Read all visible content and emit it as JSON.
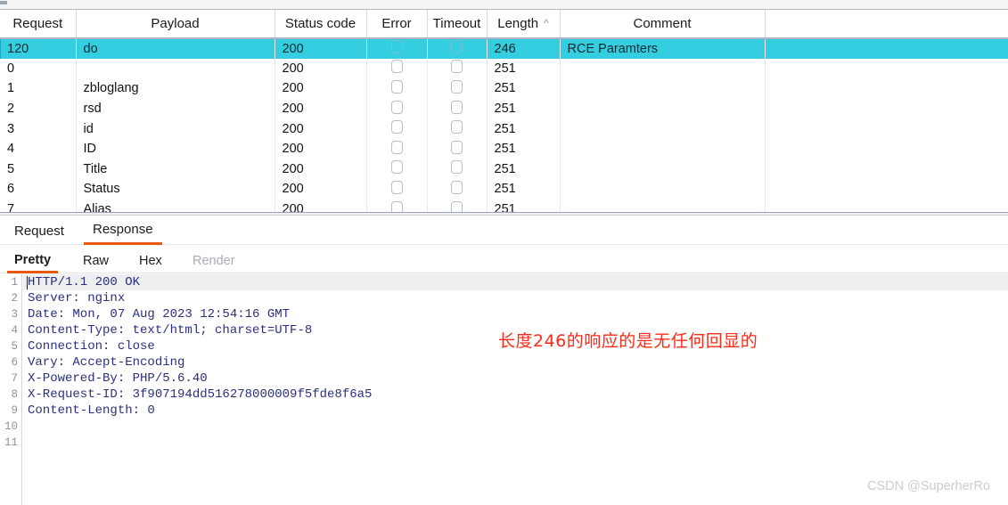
{
  "results_table": {
    "columns": [
      {
        "key": "request",
        "label": "Request"
      },
      {
        "key": "payload",
        "label": "Payload"
      },
      {
        "key": "status",
        "label": "Status code"
      },
      {
        "key": "error",
        "label": "Error"
      },
      {
        "key": "timeout",
        "label": "Timeout"
      },
      {
        "key": "length",
        "label": "Length"
      },
      {
        "key": "comment",
        "label": "Comment"
      }
    ],
    "sort": {
      "column": "Length",
      "direction": "ascending",
      "icon": "chevron-up-icon"
    },
    "selected_row_color": "#35cde0",
    "rows": [
      {
        "request": "120",
        "payload": "do",
        "status": "200",
        "error": false,
        "timeout": false,
        "length": "246",
        "comment": "RCE Paramters",
        "selected": true
      },
      {
        "request": "0",
        "payload": "",
        "status": "200",
        "error": false,
        "timeout": false,
        "length": "251",
        "comment": "",
        "selected": false
      },
      {
        "request": "1",
        "payload": "zbloglang",
        "status": "200",
        "error": false,
        "timeout": false,
        "length": "251",
        "comment": "",
        "selected": false
      },
      {
        "request": "2",
        "payload": "rsd",
        "status": "200",
        "error": false,
        "timeout": false,
        "length": "251",
        "comment": "",
        "selected": false
      },
      {
        "request": "3",
        "payload": "id",
        "status": "200",
        "error": false,
        "timeout": false,
        "length": "251",
        "comment": "",
        "selected": false
      },
      {
        "request": "4",
        "payload": "ID",
        "status": "200",
        "error": false,
        "timeout": false,
        "length": "251",
        "comment": "",
        "selected": false
      },
      {
        "request": "5",
        "payload": "Title",
        "status": "200",
        "error": false,
        "timeout": false,
        "length": "251",
        "comment": "",
        "selected": false
      },
      {
        "request": "6",
        "payload": "Status",
        "status": "200",
        "error": false,
        "timeout": false,
        "length": "251",
        "comment": "",
        "selected": false
      },
      {
        "request": "7",
        "payload": "Alias",
        "status": "200",
        "error": false,
        "timeout": false,
        "length": "251",
        "comment": "",
        "selected": false
      }
    ]
  },
  "message_tabs": {
    "items": [
      {
        "label": "Request",
        "active": false
      },
      {
        "label": "Response",
        "active": true
      }
    ],
    "active_underline_color": "#e8590c"
  },
  "view_tabs": {
    "items": [
      {
        "label": "Pretty",
        "active": true,
        "disabled": false
      },
      {
        "label": "Raw",
        "active": false,
        "disabled": false
      },
      {
        "label": "Hex",
        "active": false,
        "disabled": false
      },
      {
        "label": "Render",
        "active": false,
        "disabled": true
      }
    ]
  },
  "editor": {
    "line_numbers": [
      "1",
      "2",
      "3",
      "4",
      "5",
      "6",
      "7",
      "8",
      "9",
      "10",
      "11"
    ],
    "lines": [
      "HTTP/1.1 200 OK",
      "Server: nginx",
      "Date: Mon, 07 Aug 2023 12:54:16 GMT",
      "Content-Type: text/html; charset=UTF-8",
      "Connection: close",
      "Vary: Accept-Encoding",
      "X-Powered-By: PHP/5.6.40",
      "X-Request-ID: 3f907194dd516278000009f5fde8f6a5",
      "Content-Length: 0",
      "",
      ""
    ],
    "cursor_line": 1,
    "text_color": "#2b2f7e"
  },
  "annotation": {
    "text": "长度246的响应的是无任何回显的",
    "color": "#fc2a17"
  },
  "watermark": {
    "text": "CSDN @SuperherRo"
  }
}
